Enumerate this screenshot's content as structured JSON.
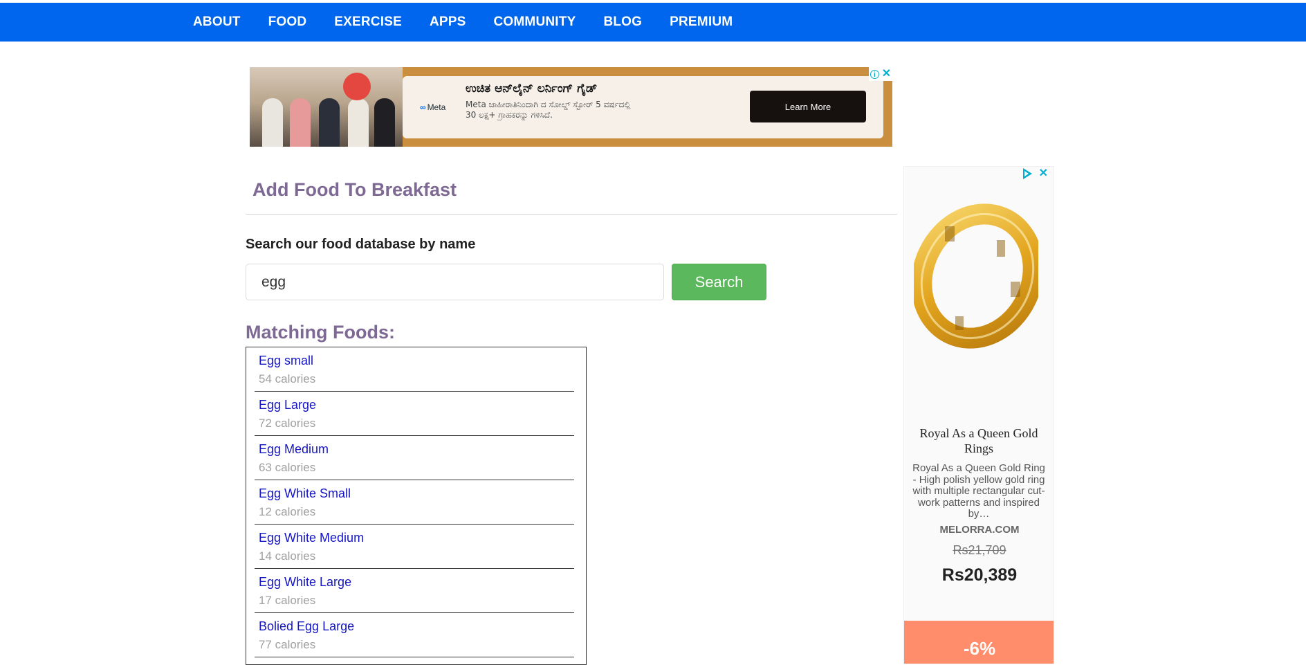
{
  "nav": {
    "items": [
      "ABOUT",
      "FOOD",
      "EXERCISE",
      "APPS",
      "COMMUNITY",
      "BLOG",
      "PREMIUM"
    ]
  },
  "top_ad": {
    "brand": "Meta",
    "headline": "ಉಚಿತ ಆನ್‌ಲೈನ್ ಲರ್ನಿಂಗ್ ಗೈಡ್",
    "body": "Meta ಜಾಹೀರಾತಿನಿಂದಾಗಿ ದ ಸೋಲ್ಡ್ ಸ್ಟೋರ್ 5 ವರ್ಷದಲ್ಲಿ 30 ಲಕ್ಷ+ ಗ್ರಾಹಕರನ್ನು ಗಳಿಸಿದೆ.",
    "cta": "Learn More",
    "info_glyph": "i",
    "close_glyph": "✕"
  },
  "page": {
    "title": "Add Food To Breakfast",
    "search_label": "Search our food database by name",
    "search_value": "egg",
    "search_button": "Search",
    "matching_title": "Matching Foods:"
  },
  "results": [
    {
      "name": "Egg small",
      "calories": "54 calories"
    },
    {
      "name": "Egg Large",
      "calories": "72 calories"
    },
    {
      "name": "Egg Medium",
      "calories": "63 calories"
    },
    {
      "name": "Egg White Small",
      "calories": "12 calories"
    },
    {
      "name": "Egg White Medium",
      "calories": "14 calories"
    },
    {
      "name": "Egg White Large",
      "calories": "17 calories"
    },
    {
      "name": "Bolied Egg Large",
      "calories": "77 calories"
    }
  ],
  "side_ad": {
    "product_title": "Royal As a Queen Gold Rings",
    "description": "Royal As a Queen Gold Ring - High polish yellow gold ring with multiple rectangular cut-work patterns and inspired by…",
    "site": "MELORRA.COM",
    "old_price": "Rs21,709",
    "price": "Rs20,389",
    "discount": "-6%",
    "close_glyph": "✕"
  },
  "colors": {
    "nav_bg": "#0066ee",
    "heading": "#7d6993",
    "link": "#1515c4",
    "search_button": "#5cb85c"
  }
}
